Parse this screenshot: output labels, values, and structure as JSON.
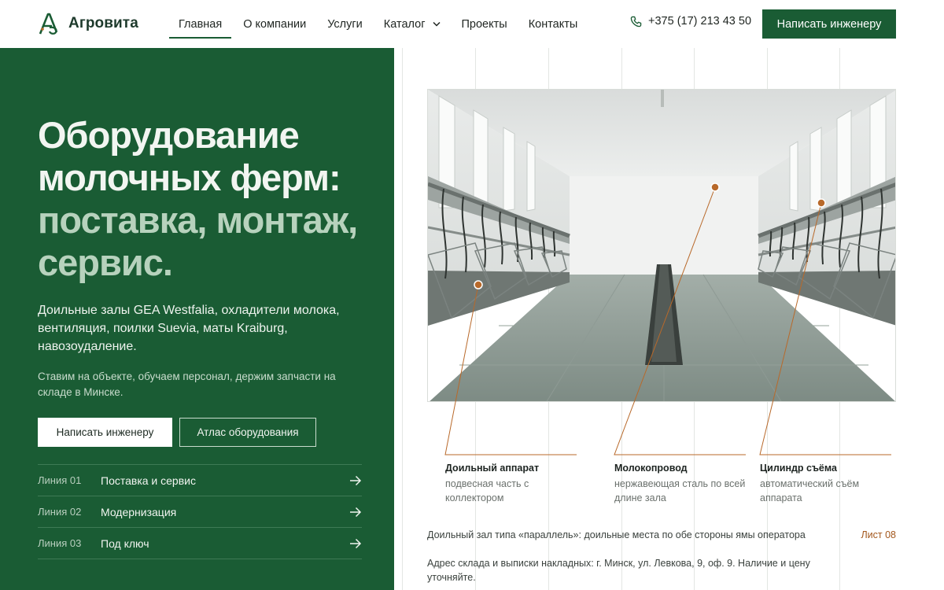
{
  "brand": {
    "name": "Агровита",
    "logo_icon": "agrovita-logo-icon"
  },
  "nav": [
    {
      "label": "Главная",
      "active": true
    },
    {
      "label": "О компании"
    },
    {
      "label": "Услуги"
    },
    {
      "label": "Каталог",
      "has_dropdown": true
    },
    {
      "label": "Проекты"
    },
    {
      "label": "Контакты"
    }
  ],
  "header": {
    "phone": "+375 (17) 213 43 50",
    "phone_icon": "phone-icon",
    "cta": "Написать инженеру"
  },
  "hero": {
    "title_main": "Оборудование молочных ферм:",
    "title_accent": "поставка, монтаж, сервис.",
    "lead": "Доильные залы GEA Westfalia, охладители молока, вентиляция, поилки Suevia, маты Kraiburg, навозоудаление.",
    "sub": "Ставим на объекте, обучаем персонал, держим запчасти на складе в Минске.",
    "primary_button": "Написать инженеру",
    "secondary_button": "Атлас оборудования",
    "lines": [
      {
        "num": "Линия 01",
        "name": "Поставка и сервис"
      },
      {
        "num": "Линия 02",
        "name": "Модернизация"
      },
      {
        "num": "Линия 03",
        "name": "Под ключ"
      }
    ]
  },
  "sheet": {
    "annotations": [
      {
        "title": "Доильный аппарат",
        "desc": "подвесная часть с коллектором"
      },
      {
        "title": "Молокопровод",
        "desc": "нержавеющая сталь по всей длине зала"
      },
      {
        "title": "Цилиндр съёма",
        "desc": "автоматический съём аппарата"
      }
    ],
    "caption": "Доильный зал типа «параллель»: доильные места по обе стороны ямы оператора",
    "sheet_number": "Лист 08",
    "address": "Адрес склада и выписки накладных: г. Минск, ул. Левкова, 9, оф. 9. Наличие и цену уточняйте."
  },
  "colors": {
    "brand_green": "#1a5c34",
    "accent_light_green": "#b7d2bd",
    "annotation_orange": "#b8692a"
  }
}
